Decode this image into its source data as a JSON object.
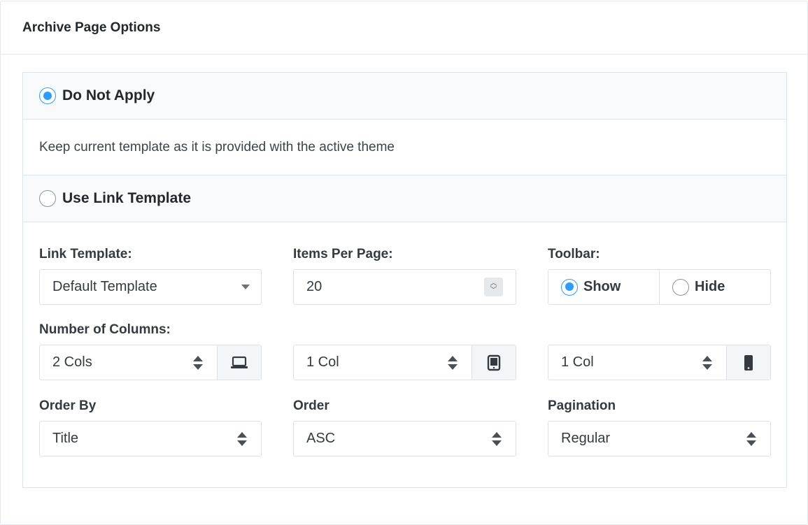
{
  "card": {
    "title": "Archive Page Options"
  },
  "options": {
    "do_not_apply": {
      "label": "Do Not Apply",
      "checked": true
    },
    "description": "Keep current template as it is provided with the active theme",
    "use_link_template": {
      "label": "Use Link Template",
      "checked": false
    }
  },
  "fields": {
    "link_template": {
      "label": "Link Template:",
      "value": "Default Template"
    },
    "items_per_page": {
      "label": "Items Per Page:",
      "value": "20"
    },
    "toolbar": {
      "label": "Toolbar:",
      "show": "Show",
      "hide": "Hide",
      "selected": "Show"
    },
    "columns": {
      "label": "Number of Columns:",
      "desktop": {
        "value": "2 Cols",
        "icon": "laptop-icon"
      },
      "tablet": {
        "value": "1 Col",
        "icon": "tablet-icon"
      },
      "mobile": {
        "value": "1 Col",
        "icon": "mobile-icon"
      }
    },
    "order_by": {
      "label": "Order By",
      "value": "Title"
    },
    "order": {
      "label": "Order",
      "value": "ASC"
    },
    "pagination": {
      "label": "Pagination",
      "value": "Regular"
    }
  },
  "colors": {
    "accent": "#2c9cff",
    "panel_bg": "#f8fafc",
    "border": "#dde5ec"
  }
}
